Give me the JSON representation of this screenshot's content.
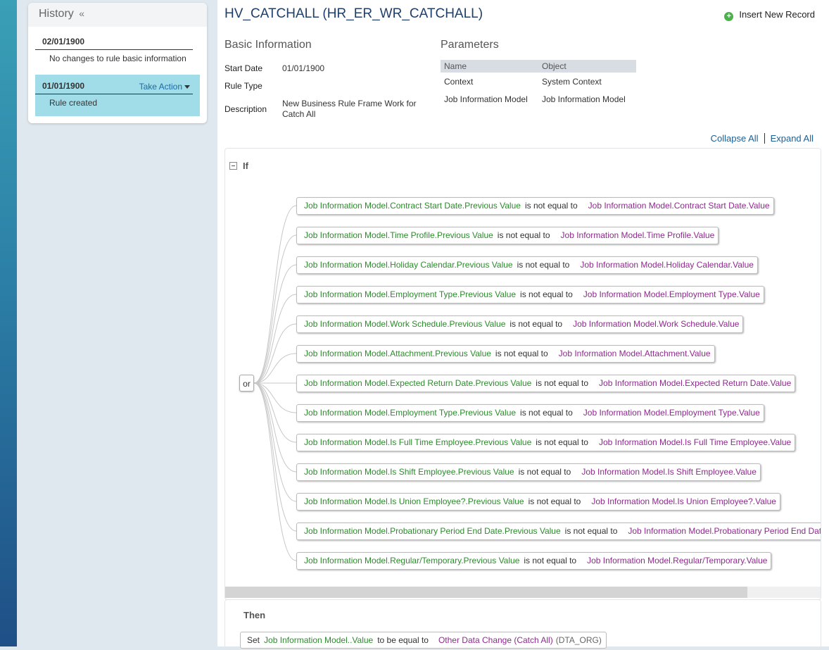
{
  "history": {
    "title": "History",
    "collapse_glyph": "«",
    "entries": [
      {
        "date": "02/01/1900",
        "text": "No changes to rule basic information"
      },
      {
        "date": "01/01/1900",
        "text": "Rule created",
        "action": "Take Action"
      }
    ]
  },
  "header": {
    "title": "HV_CATCHALL (HR_ER_WR_CATCHALL)",
    "insert_label": "Insert New Record"
  },
  "basic_info": {
    "heading": "Basic Information",
    "start_date_label": "Start Date",
    "start_date": "01/01/1900",
    "rule_type_label": "Rule Type",
    "rule_type": "",
    "description_label": "Description",
    "description": "New Business Rule Frame Work for Catch All"
  },
  "parameters": {
    "heading": "Parameters",
    "columns": [
      "Name",
      "Object"
    ],
    "rows": [
      [
        "Context",
        "System Context"
      ],
      [
        "Job Information Model",
        "Job Information Model"
      ]
    ]
  },
  "links": {
    "collapse": "Collapse All",
    "expand": "Expand All"
  },
  "if_section": {
    "label": "If",
    "operator": "or",
    "conditions": [
      {
        "left": "Job Information Model.Contract Start Date.Previous Value",
        "op": "is not equal to",
        "right": "Job Information Model.Contract Start Date.Value"
      },
      {
        "left": "Job Information Model.Time Profile.Previous Value",
        "op": "is not equal to",
        "right": "Job Information Model.Time Profile.Value"
      },
      {
        "left": "Job Information Model.Holiday Calendar.Previous Value",
        "op": "is not equal to",
        "right": "Job Information Model.Holiday Calendar.Value"
      },
      {
        "left": "Job Information Model.Employment Type.Previous Value",
        "op": "is not equal to",
        "right": "Job Information Model.Employment Type.Value"
      },
      {
        "left": "Job Information Model.Work Schedule.Previous Value",
        "op": "is not equal to",
        "right": "Job Information Model.Work Schedule.Value"
      },
      {
        "left": "Job Information Model.Attachment.Previous Value",
        "op": "is not equal to",
        "right": "Job Information Model.Attachment.Value"
      },
      {
        "left": "Job Information Model.Expected Return Date.Previous Value",
        "op": "is not equal to",
        "right": "Job Information Model.Expected Return Date.Value"
      },
      {
        "left": "Job Information Model.Employment Type.Previous Value",
        "op": "is not equal to",
        "right": "Job Information Model.Employment Type.Value"
      },
      {
        "left": "Job Information Model.Is Full Time Employee.Previous Value",
        "op": "is not equal to",
        "right": "Job Information Model.Is Full Time Employee.Value"
      },
      {
        "left": "Job Information Model.Is Shift Employee.Previous Value",
        "op": "is not equal to",
        "right": "Job Information Model.Is Shift Employee.Value"
      },
      {
        "left": "Job Information Model.Is Union Employee?.Previous Value",
        "op": "is not equal to",
        "right": "Job Information Model.Is Union Employee?.Value"
      },
      {
        "left": "Job Information Model.Probationary Period End Date.Previous Value",
        "op": "is not equal to",
        "right": "Job Information Model.Probationary Period End Date.Value"
      },
      {
        "left": "Job Information Model.Regular/Temporary.Previous Value",
        "op": "is not equal to",
        "right": "Job Information Model.Regular/Temporary.Value"
      }
    ]
  },
  "then_section": {
    "label": "Then",
    "set": "Set",
    "field": "Job Information Model..Value",
    "op": "to be equal to",
    "value": "Other Data Change (Catch All)",
    "code": "(DTA_ORG)"
  },
  "colors": {
    "left_operand": "#2d8a2d",
    "right_operand": "#8e2a8e",
    "link": "#1b5e95",
    "active_history": "#a0dde9"
  }
}
